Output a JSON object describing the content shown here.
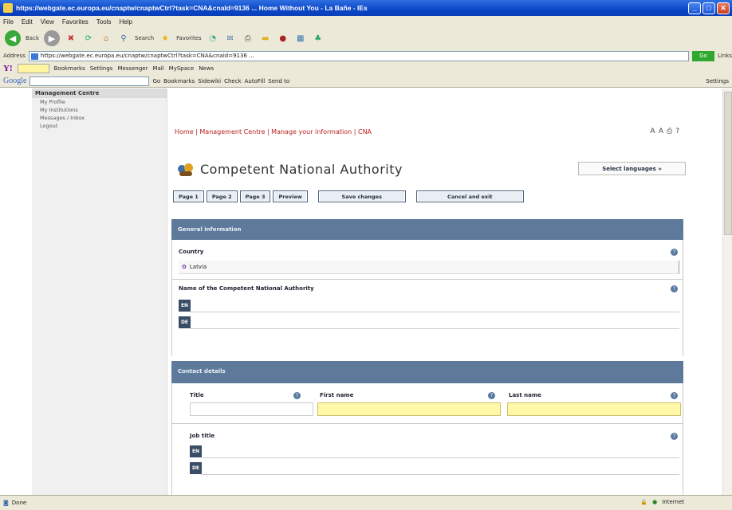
{
  "window": {
    "title": "https://webgate.ec.europa.eu/cnaptw/cnaptwCtrl?task=CNA&cnaId=9136 ... Home Without You - La Bañe - IEs"
  },
  "menu": [
    "File",
    "Edit",
    "View",
    "Favorites",
    "Tools",
    "Help"
  ],
  "nav": {
    "back_label": "Back",
    "search_label": "Search",
    "favorites_label": "Favorites"
  },
  "address": {
    "label": "Address",
    "url": "https://webgate.ec.europa.eu/cnaptw/cnaptwCtrl?task=CNA&cnaId=9136 ... ",
    "go_label": "Go",
    "links_label": "Links"
  },
  "yahoo": {
    "logo": "Y!",
    "items": [
      "Bookmarks",
      "Settings",
      "Messenger",
      "Mail",
      "MySpace",
      "News"
    ]
  },
  "google": {
    "logo": "Google",
    "items": [
      "Go",
      "Bookmarks",
      "Sidewiki",
      "Check",
      "AutoFill",
      "Send to"
    ],
    "settings_label": "Settings"
  },
  "sidebar": {
    "heading": "Management Centre",
    "items": [
      "My Profile",
      "My Institutions",
      "Messages / Inbox",
      "Logout"
    ]
  },
  "breadcrumb": "Home | Management Centre | Manage your information | CNA",
  "page": {
    "title": "Competent National Authority",
    "select_language": "Select languages »"
  },
  "tabs": [
    "Page 1",
    "Page 2",
    "Page 3",
    "Preview",
    "Save changes",
    "Cancel and exit"
  ],
  "general": {
    "heading": "General information",
    "country_label": "Country",
    "country_value": "Latvia",
    "authority_label": "Name of the Competent National Authority",
    "lang_tags": [
      "EN",
      "DE"
    ]
  },
  "contact": {
    "heading": "Contact details",
    "title_label": "Title",
    "first_name_label": "First name",
    "last_name_label": "Last name",
    "job_title_label": "Job title",
    "lang_tags": [
      "EN",
      "DE"
    ]
  },
  "status": {
    "left": "Done",
    "zone": "Internet"
  }
}
